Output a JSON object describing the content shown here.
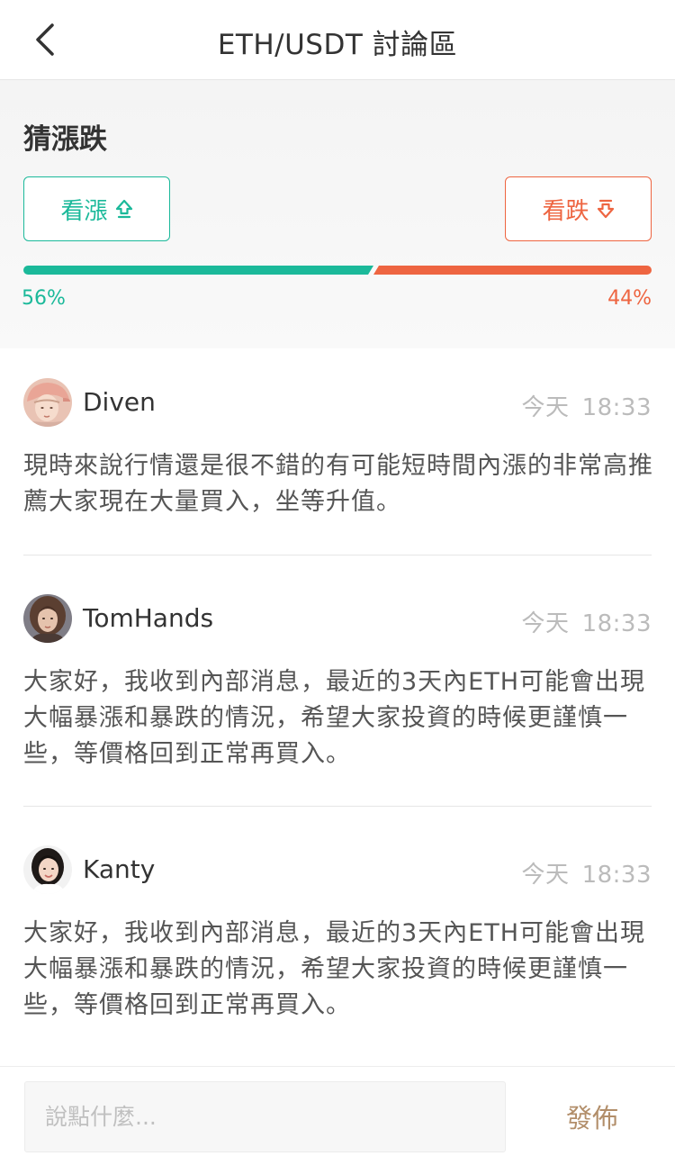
{
  "header": {
    "title": "ETH/USDT 討論區",
    "back_icon": "chevron-left-icon"
  },
  "guess": {
    "title": "猜漲跌",
    "bull_label": "看漲",
    "bull_icon": "arrow-up-icon",
    "bear_label": "看跌",
    "bear_icon": "arrow-down-icon",
    "bull_percent": "56%",
    "bear_percent": "44%",
    "bull_fraction": 0.56,
    "bear_fraction": 0.44,
    "colors": {
      "bull": "#1bb99a",
      "bear": "#ee6541"
    }
  },
  "comments": [
    {
      "user": "Diven",
      "day": "今天",
      "time": "18:33",
      "content": "現時來說行情還是很不錯的有可能短時間內漲的非常高推薦大家現在大量買入，坐等升值。"
    },
    {
      "user": "TomHands",
      "day": "今天",
      "time": "18:33",
      "content": "大家好，我收到內部消息，最近的3天內ETH可能會出現大幅暴漲和暴跌的情況，希望大家投資的時候更謹慎一些，等價格回到正常再買入。"
    },
    {
      "user": "Kanty",
      "day": "今天",
      "time": "18:33",
      "content": "大家好，我收到內部消息，最近的3天內ETH可能會出現大幅暴漲和暴跌的情況，希望大家投資的時候更謹慎一些，等價格回到正常再買入。"
    }
  ],
  "composer": {
    "placeholder": "說點什麼...",
    "value": "",
    "publish_label": "發佈",
    "publish_color": "#b28e6a"
  }
}
